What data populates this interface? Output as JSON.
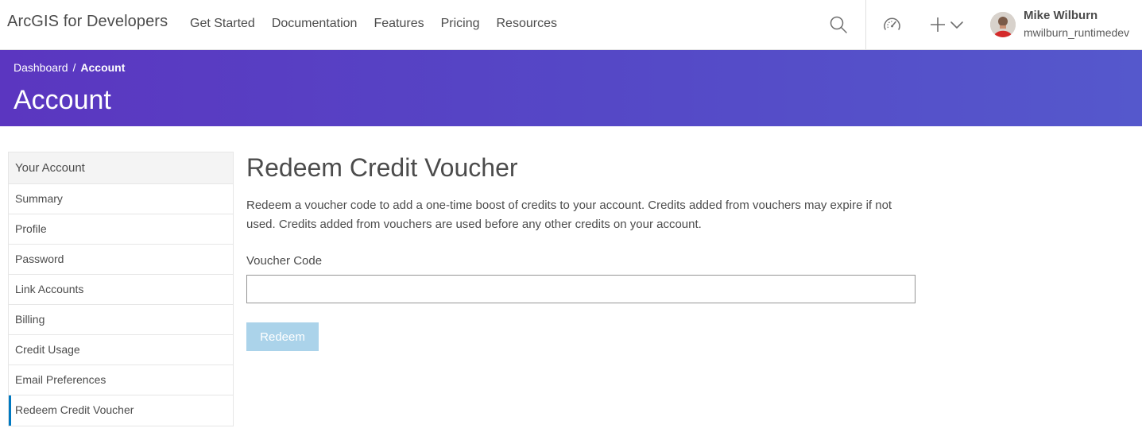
{
  "header": {
    "brand": "ArcGIS for Developers",
    "nav": [
      "Get Started",
      "Documentation",
      "Features",
      "Pricing",
      "Resources"
    ],
    "icons": [
      "search-icon",
      "gauge-icon",
      "plus-icon",
      "chevron-down-icon"
    ],
    "user": {
      "name": "Mike Wilburn",
      "handle": "mwilburn_runtimedev"
    }
  },
  "banner": {
    "breadcrumb": {
      "parent": "Dashboard",
      "separator": "/",
      "current": "Account"
    },
    "title": "Account",
    "colors": {
      "gradient_start": "#5b36c0",
      "gradient_end": "#5558cc"
    }
  },
  "sidebar": {
    "heading": "Your Account",
    "items": [
      {
        "label": "Summary",
        "active": false
      },
      {
        "label": "Profile",
        "active": false
      },
      {
        "label": "Password",
        "active": false
      },
      {
        "label": "Link Accounts",
        "active": false
      },
      {
        "label": "Billing",
        "active": false
      },
      {
        "label": "Credit Usage",
        "active": false
      },
      {
        "label": "Email Preferences",
        "active": false
      },
      {
        "label": "Redeem Credit Voucher",
        "active": true
      }
    ],
    "active_color": "#0079c1"
  },
  "main": {
    "title": "Redeem Credit Voucher",
    "description": "Redeem a voucher code to add a one-time boost of credits to your account. Credits added from vouchers may expire if not used. Credits added from vouchers are used before any other credits on your account.",
    "voucher_label": "Voucher Code",
    "voucher_value": "",
    "redeem_label": "Redeem",
    "redeem_color": "#abd3ea"
  }
}
